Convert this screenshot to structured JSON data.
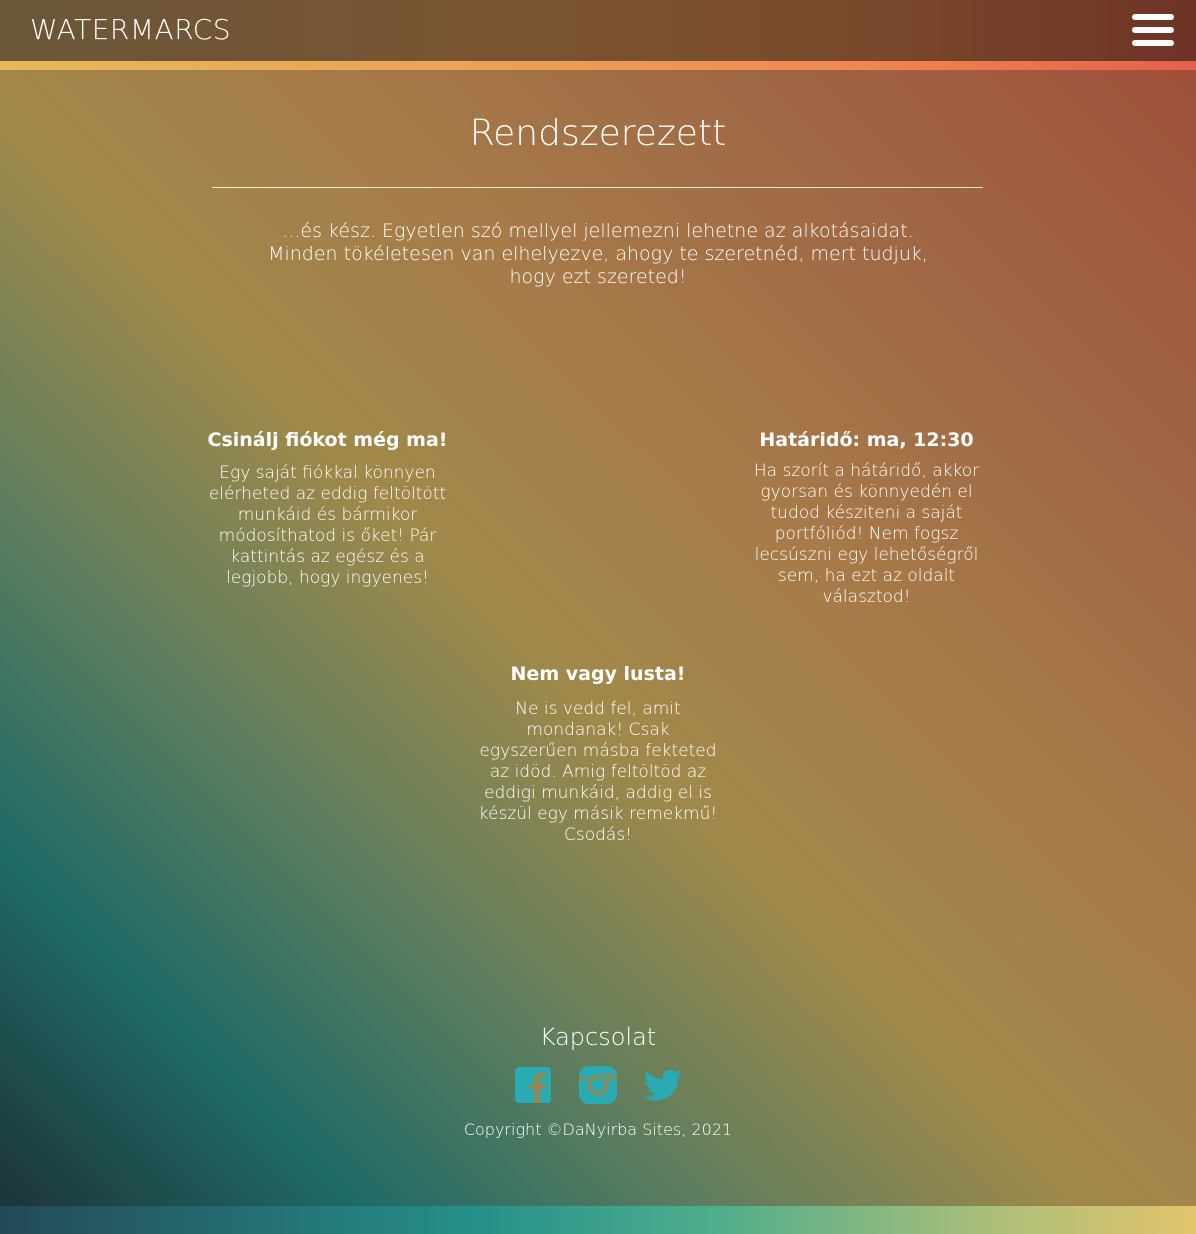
{
  "header": {
    "brand": "WATERMARCS",
    "menu_icon": "hamburger-menu-icon"
  },
  "hero": {
    "title": "Rendszerezett",
    "text": "...és kész. Egyetlen szó mellyel jellemezni lehetne az alkotásaidat. Minden tökéletesen van elhelyezve, ahogy te szeretnéd, mert tudjuk, hogy ezt szereted!"
  },
  "features": {
    "account": {
      "title": "Csinálj fiókot még ma!",
      "text": "Egy saját fiókkal könnyen elérheted az eddig feltöltött munkáid és bármikor módosíthatod is őket! Pár kattintás az egész és a legjobb, hogy ingyenes!"
    },
    "deadline": {
      "title": "Határidő: ma, 12:30",
      "text": "Ha szorít a hátáridő, akkor gyorsan és könnyedén el tudod késziteni a saját portfóliód! Nem fogsz lecsúszni egy lehetőségről sem, ha ezt az oldalt választod!"
    },
    "lazy": {
      "title": "Nem vagy lusta!",
      "text": "Ne is vedd fel, amit mondanak! Csak egyszerűen másba fekteted az idöd. Amig feltöltöd az eddigi munkáid, addig el is készül egy másik remekmű! Csodás!"
    }
  },
  "footer": {
    "contact_title": "Kapcsolat",
    "socials": [
      {
        "icon": "facebook-icon"
      },
      {
        "icon": "instagram-icon"
      },
      {
        "icon": "twitter-icon"
      }
    ],
    "copyright": "Copyright ©DaNyirba Sites, 2021",
    "icon_color": "#2aaab3"
  },
  "colors": {
    "top_accent": "#ef8a52",
    "bottom_accent": "#26908a"
  }
}
